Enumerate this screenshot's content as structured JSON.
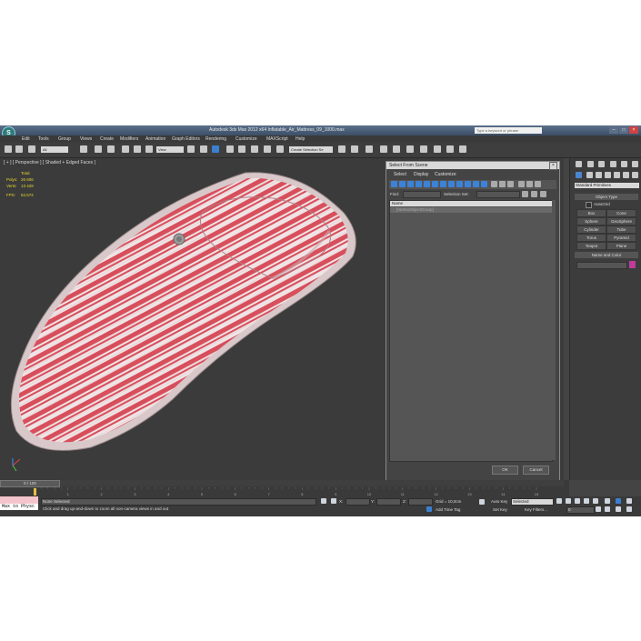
{
  "window": {
    "title": "Autodesk 3ds Max  2012 x64      Inflatable_Air_Mattress_09_1000.max",
    "search_placeholder": "Type a keyword or phrase",
    "logo_text": "S"
  },
  "menubar": [
    "Edit",
    "Tools",
    "Group",
    "Views",
    "Create",
    "Modifiers",
    "Animation",
    "Graph Editors",
    "Rendering",
    "Customize",
    "MAXScript",
    "Help"
  ],
  "toolbar": {
    "filter_dropdown": "All",
    "view_dropdown": "View",
    "selection_set_dropdown": "Create Selection Se"
  },
  "viewport": {
    "label": "[ + ] [ Perspective ] [ Shaded + Edged Faces ]",
    "stats": [
      {
        "label": "",
        "value": "Total"
      },
      {
        "label": "Polys:",
        "value": "26 606"
      },
      {
        "label": "Verts:",
        "value": "13 428"
      },
      {
        "label": "FPS:",
        "value": "52,572"
      }
    ],
    "accent_colors": {
      "stripe_red": "#d94f5c",
      "stripe_white": "#efe3e5",
      "background": "#3b3b3b"
    }
  },
  "command_panel": {
    "dropdown": "Standard Primitives",
    "object_type_title": "Object Type",
    "autogrid_label": "AutoGrid",
    "buttons": [
      "Box",
      "Cone",
      "Sphere",
      "GeoSphere",
      "Cylinder",
      "Tube",
      "Torus",
      "Pyramid",
      "Teapot",
      "Plane"
    ],
    "name_color_title": "Name and Color"
  },
  "dialog": {
    "title": "Select From Scene",
    "menu": [
      "Select",
      "Display",
      "Customize"
    ],
    "find_label": "Find:",
    "selection_set_label": "Selection Set:",
    "list_header": "Name",
    "list_items": [
      "[VertexObjectGroup]"
    ],
    "ok_label": "OK",
    "cancel_label": "Cancel"
  },
  "timeline": {
    "frame_counter": "0 / 100",
    "ticks": [
      "0",
      "5",
      "10",
      "15",
      "20",
      "25",
      "30",
      "35",
      "40",
      "45",
      "50",
      "55",
      "60",
      "65",
      "70",
      "75",
      "80",
      "85",
      "90",
      "95",
      "100"
    ],
    "bottom_ticks": [
      "0",
      "1",
      "2",
      "3",
      "4",
      "5",
      "6",
      "7",
      "8",
      "9",
      "10",
      "11",
      "12",
      "13",
      "14",
      "15"
    ]
  },
  "statusbar": {
    "listener_text": "Max to Physc",
    "selection_status": "None Selected",
    "prompt": "Click and drag up-and-down to zoom all non-camera views in and out",
    "x_label": "X:",
    "y_label": "Y:",
    "z_label": "Z:",
    "grid": "Grid = 10,0cm",
    "auto_key": "Auto Key",
    "auto_key_dropdown": "Selected",
    "set_key": "Set Key",
    "key_filters": "Key Filters...",
    "add_time_tag": "Add Time Tag",
    "frame_value": "0"
  }
}
